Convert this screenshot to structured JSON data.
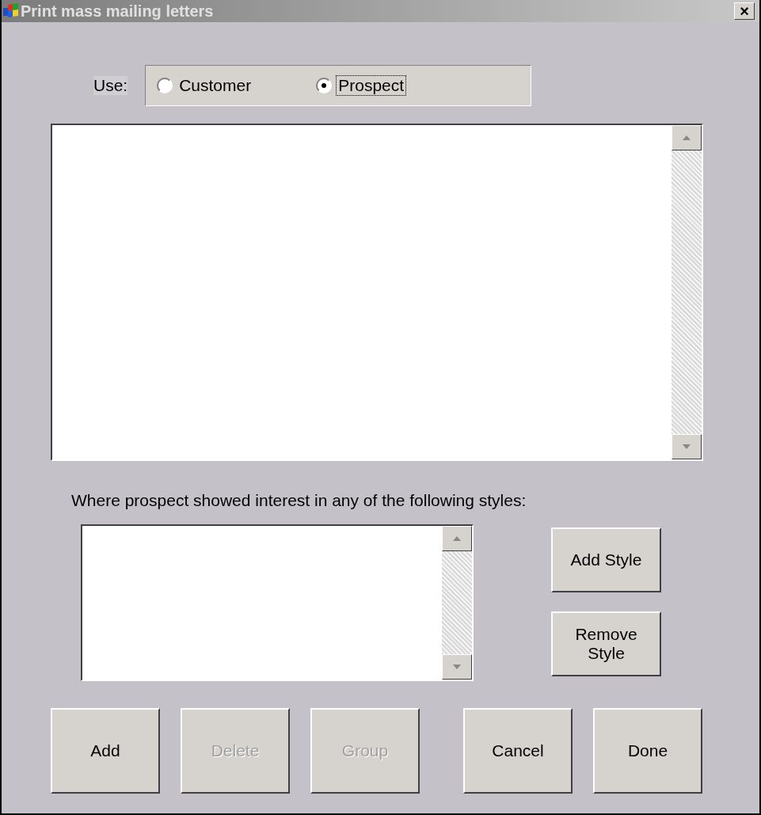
{
  "window": {
    "title": "Print mass mailing letters",
    "close": "×"
  },
  "use": {
    "label": "Use:",
    "options": [
      {
        "label": "Customer",
        "selected": false
      },
      {
        "label": "Prospect",
        "selected": true
      }
    ]
  },
  "styles_label": "Where prospect showed interest in any of the following styles:",
  "side_buttons": [
    {
      "label": "Add Style",
      "disabled": false
    },
    {
      "label": "Remove Style",
      "disabled": false
    }
  ],
  "buttons": [
    {
      "label": "Add",
      "disabled": false
    },
    {
      "label": "Delete",
      "disabled": true
    },
    {
      "label": "Group",
      "disabled": true
    },
    {
      "label": "Cancel",
      "disabled": false
    },
    {
      "label": "Done",
      "disabled": false
    }
  ]
}
